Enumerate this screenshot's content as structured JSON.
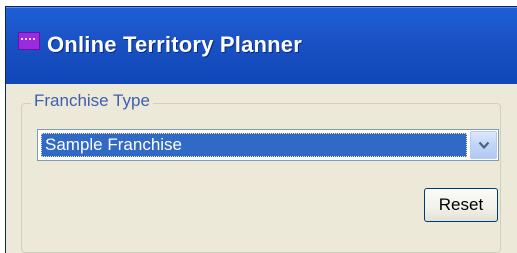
{
  "window": {
    "title": "Online Territory Planner",
    "icon": "app-icon"
  },
  "franchise": {
    "group_label": "Franchise Type",
    "selected_value": "Sample Franchise"
  },
  "actions": {
    "reset_label": "Reset"
  },
  "colors": {
    "titlebar": "#0f47b8",
    "window_bg": "#ece9d8",
    "selection": "#316ac5",
    "group_label": "#3e5fb0"
  }
}
